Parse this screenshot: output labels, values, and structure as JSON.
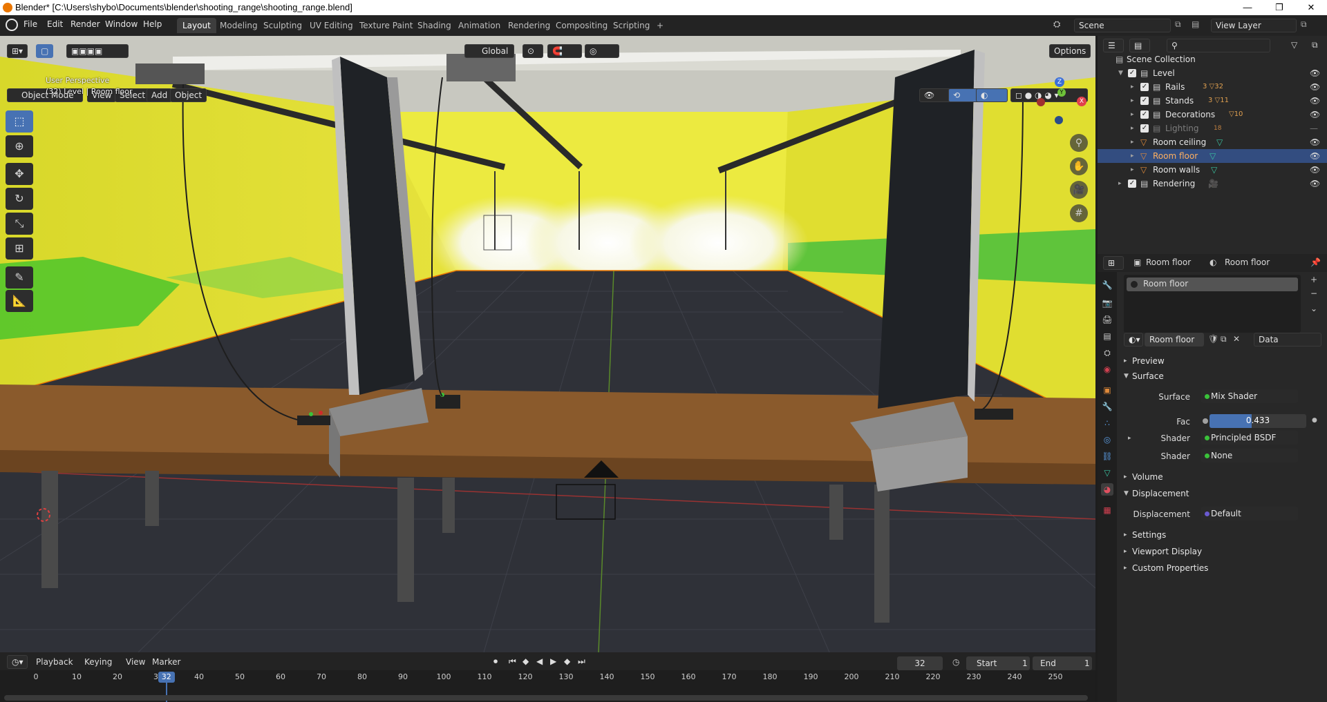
{
  "window": {
    "title": "Blender* [C:\\Users\\shybo\\Documents\\blender\\shooting_range\\shooting_range.blend]",
    "minimize": "—",
    "maximize": "❐",
    "close": "✕"
  },
  "menus": [
    "File",
    "Edit",
    "Render",
    "Window",
    "Help"
  ],
  "workspaces": [
    "Layout",
    "Modeling",
    "Sculpting",
    "UV Editing",
    "Texture Paint",
    "Shading",
    "Animation",
    "Rendering",
    "Compositing",
    "Scripting"
  ],
  "workspace_add": "+",
  "scene": {
    "name": "Scene",
    "view_layer": "View Layer"
  },
  "viewport": {
    "mode": "Object Mode",
    "header_menus": [
      "View",
      "Select",
      "Add",
      "Object"
    ],
    "transform_orientation": "Global",
    "options": "Options",
    "perspective_label": "User Perspective",
    "context_label": "(32) Level | Room floor",
    "gizmo_axes": {
      "x": "X",
      "y": "Y",
      "z": "Z"
    }
  },
  "outliner": {
    "root": "Scene Collection",
    "rows": [
      {
        "name": "Level",
        "depth": 1,
        "badge": ""
      },
      {
        "name": "Rails",
        "depth": 2,
        "badge": "3 ▽32"
      },
      {
        "name": "Stands",
        "depth": 2,
        "badge": "3 ▽11"
      },
      {
        "name": "Decorations",
        "depth": 2,
        "badge": "▽10"
      },
      {
        "name": "Lighting",
        "depth": 2,
        "badge": "18"
      },
      {
        "name": "Room ceiling",
        "depth": 2,
        "badge": ""
      },
      {
        "name": "Room floor",
        "depth": 2,
        "badge": ""
      },
      {
        "name": "Room walls",
        "depth": 2,
        "badge": ""
      },
      {
        "name": "Rendering",
        "depth": 1,
        "badge": ""
      }
    ]
  },
  "properties": {
    "breadcrumb_object": "Room floor",
    "breadcrumb_material": "Room floor",
    "slot_name": "Room floor",
    "material_name": "Room floor",
    "link_mode": "Data",
    "sections": {
      "preview": "Preview",
      "surface": "Surface",
      "volume": "Volume",
      "displacement": "Displacement",
      "settings": "Settings",
      "viewport_display": "Viewport Display",
      "custom_properties": "Custom Properties"
    },
    "surface_label": "Surface",
    "surface_value": "Mix Shader",
    "fac_label": "Fac",
    "fac_value": "0.433",
    "fac_fraction": 0.433,
    "shader1_label": "Shader",
    "shader1_value": "Principled BSDF",
    "shader2_label": "Shader",
    "shader2_value": "None",
    "displacement_label": "Displacement",
    "displacement_value": "Default"
  },
  "timeline": {
    "menus": [
      "Playback",
      "Keying",
      "View",
      "Marker"
    ],
    "current_frame": "32",
    "start_label": "Start",
    "start_value": "1",
    "end_label": "End",
    "end_value": "1",
    "ruler": [
      "0",
      "10",
      "20",
      "30",
      "40",
      "50",
      "60",
      "70",
      "80",
      "90",
      "100",
      "110",
      "120",
      "130",
      "140",
      "150",
      "160",
      "170",
      "180",
      "190",
      "200",
      "210",
      "220",
      "230",
      "240",
      "250"
    ]
  },
  "colors": {
    "accent": "#4772b3",
    "selection": "#334d80",
    "origin": "#ea7600"
  }
}
